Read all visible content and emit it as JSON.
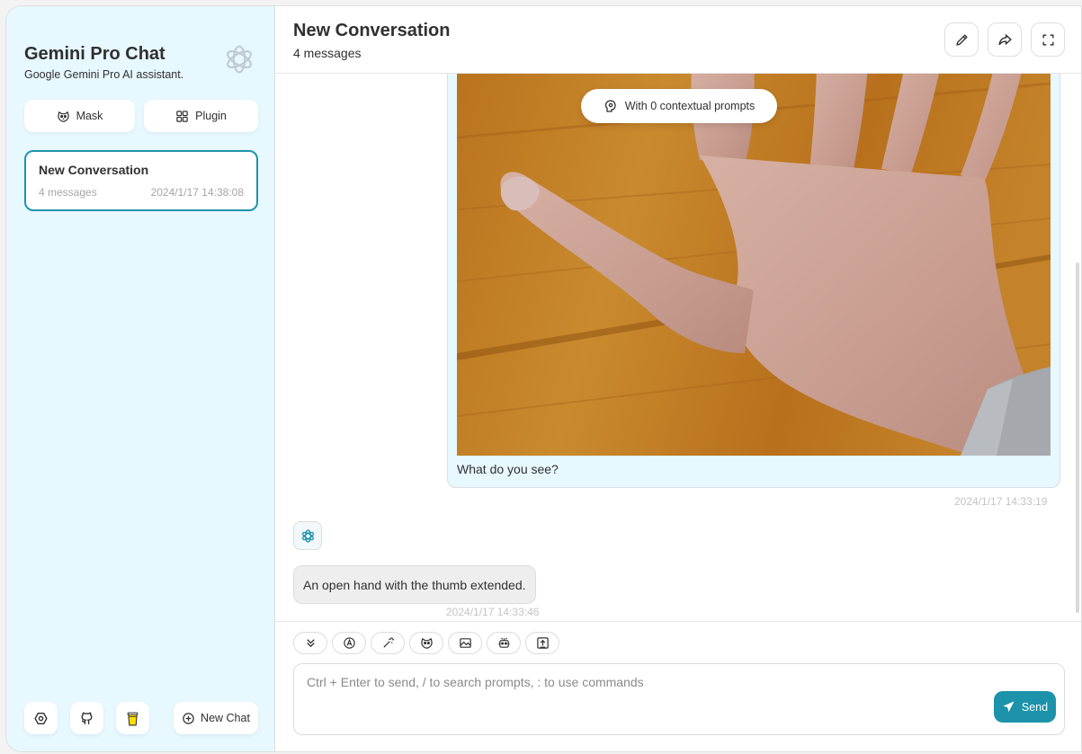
{
  "sidebar": {
    "title": "Gemini Pro Chat",
    "subtitle": "Google Gemini Pro AI assistant.",
    "mask_label": "Mask",
    "plugin_label": "Plugin",
    "chats": [
      {
        "title": "New Conversation",
        "count": "4 messages",
        "time": "2024/1/17 14:38:08"
      }
    ],
    "new_chat_label": "New Chat"
  },
  "header": {
    "title": "New Conversation",
    "subtitle": "4 messages"
  },
  "context": {
    "label": "With 0 contextual prompts"
  },
  "messages": [
    {
      "role": "user",
      "image": "hand-photo",
      "text": "What do you see?",
      "time": "2024/1/17 14:33:19"
    },
    {
      "role": "assistant",
      "text": "An open hand with the thumb extended.",
      "time": "2024/1/17 14:33:46"
    }
  ],
  "input": {
    "placeholder": "Ctrl + Enter to send, / to search prompts, : to use commands",
    "value": "",
    "send_label": "Send"
  },
  "icons": {
    "toolbar": [
      "chevrons-down-icon",
      "model-icon",
      "magic-wand-icon",
      "mask-icon",
      "image-icon",
      "robot-icon",
      "export-icon"
    ]
  },
  "colors": {
    "accent": "#1d93ab",
    "sidebar_bg": "#e7f8ff",
    "user_bubble": "#e7f8ff",
    "bot_bubble": "#eeeeee"
  }
}
